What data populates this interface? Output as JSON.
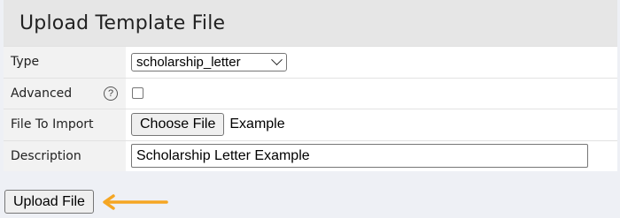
{
  "panel": {
    "title": "Upload Template File"
  },
  "form": {
    "type": {
      "label": "Type",
      "selected": "scholarship_letter"
    },
    "advanced": {
      "label": "Advanced",
      "help_glyph": "?",
      "checked": false
    },
    "file": {
      "label": "File To Import",
      "button_label": "Choose File",
      "file_name": "Example"
    },
    "description": {
      "label": "Description",
      "value": "Scholarship Letter Example"
    }
  },
  "actions": {
    "upload_label": "Upload File"
  },
  "colors": {
    "annotation_arrow": "#f5a623",
    "header_bg": "#e6e6e6",
    "page_bg": "#eef0f5"
  },
  "icons": {
    "dropdown": "chevron-down-icon",
    "help": "help-icon",
    "annotation": "arrow-left-icon"
  }
}
